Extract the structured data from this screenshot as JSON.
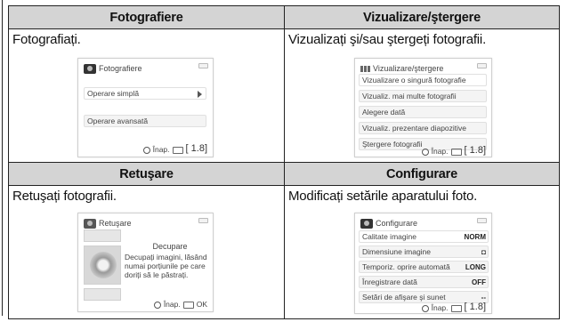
{
  "sections": [
    {
      "header": "Fotografiere",
      "description": "Fotografiați.",
      "screen": {
        "title": "Fotografiere",
        "items": [
          "Operare simplă",
          "Operare avansată"
        ],
        "footer_back": "Înap.",
        "footer_zoom": "1.8"
      }
    },
    {
      "header": "Vizualizare/ştergere",
      "description": "Vizualizați şi/sau ştergeți fotografii.",
      "screen": {
        "title": "Vizualizare/ştergere",
        "items": [
          "Vizualizare o singură fotografie",
          "Vizualiz. mai multe fotografii",
          "Alegere dată",
          "Vizualiz. prezentare diapozitive",
          "Ştergere fotografii"
        ],
        "footer_back": "Înap.",
        "footer_zoom": "1.8"
      }
    },
    {
      "header": "Retuşare",
      "description": "Retuşați fotografii.",
      "screen": {
        "title": "Retuşare",
        "option_title": "Decupare",
        "option_text": "Decupați imagini, lăsând numai porțiunile pe care doriți să le păstrați.",
        "footer_back": "Înap.",
        "footer_ok": "OK"
      }
    },
    {
      "header": "Configurare",
      "description": "Modificați setările aparatului foto.",
      "screen": {
        "title": "Configurare",
        "items": [
          {
            "label": "Calitate imagine",
            "value": "NORM"
          },
          {
            "label": "Dimensiune imagine",
            "value": "◘"
          },
          {
            "label": "Temporiz. oprire automată",
            "value": "LONG"
          },
          {
            "label": "Înregistrare dată",
            "value": "OFF"
          },
          {
            "label": "Setări de afişare şi sunet",
            "value": "--"
          }
        ],
        "footer_back": "Înap.",
        "footer_zoom": "1.8"
      }
    }
  ]
}
